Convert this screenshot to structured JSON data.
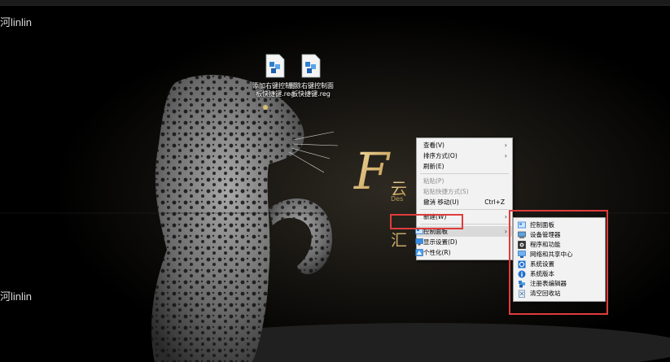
{
  "watermark_top": "河linlin",
  "watermark_bottom": "河linlin",
  "desktop_icons": [
    {
      "label": "添加右键控制面板快捷键.reg"
    },
    {
      "label": "删除右键控制面板快捷键.reg"
    }
  ],
  "context_menu": {
    "items": [
      {
        "label": "查看(V)"
      },
      {
        "label": "排序方式(O)"
      },
      {
        "label": "刷新(E)"
      },
      {
        "label": "粘贴(P)"
      },
      {
        "label": "粘贴快捷方式(S)"
      },
      {
        "label": "撤消 移动(U)",
        "shortcut": "Ctrl+Z"
      },
      {
        "label": "新建(W)"
      },
      {
        "label": "控制面板"
      },
      {
        "label": "显示设置(D)"
      },
      {
        "label": "个性化(R)"
      }
    ]
  },
  "submenu": {
    "items": [
      {
        "label": "控制面板"
      },
      {
        "label": "设备管理器"
      },
      {
        "label": "程序和功能"
      },
      {
        "label": "网络和共享中心"
      },
      {
        "label": "系统设置"
      },
      {
        "label": "系统版本"
      },
      {
        "label": "注册表编辑器"
      },
      {
        "label": "清空回收站"
      }
    ]
  },
  "colors": {
    "highlight_box": "#e03c3c",
    "menu_bg": "#f2f2f2"
  }
}
